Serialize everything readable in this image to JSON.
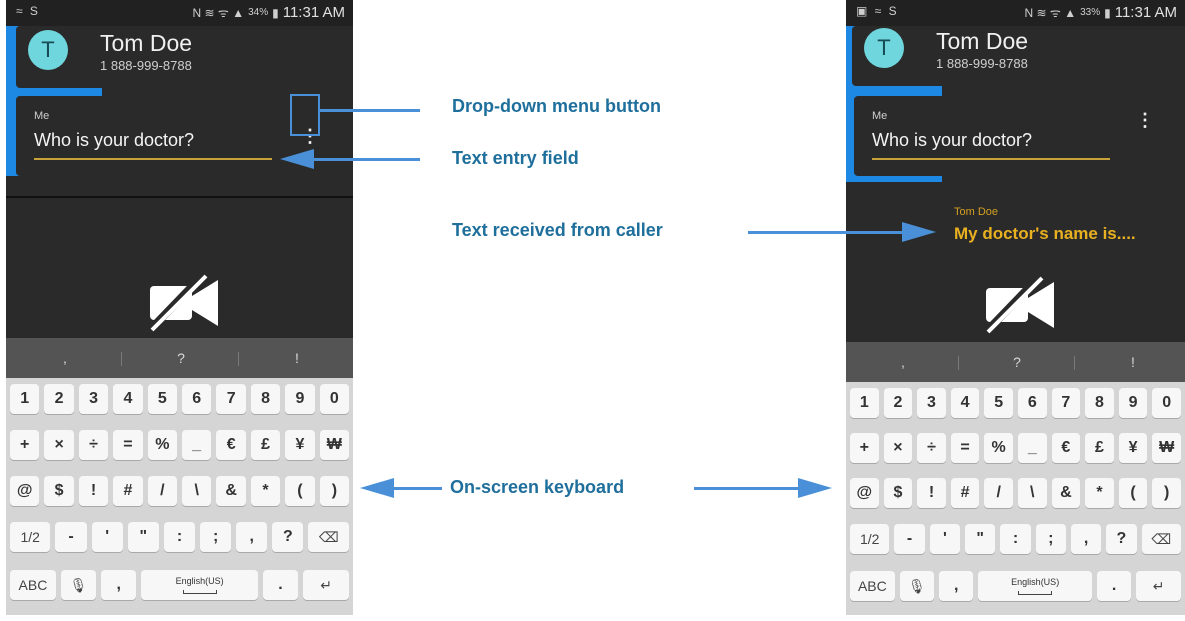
{
  "left_phone": {
    "status": {
      "left_icons": "≈ S",
      "signal_icons": "N ≋ ᯤ ▲",
      "battery": "34%",
      "time": "11:31 AM"
    },
    "contact": {
      "initial": "T",
      "name": "Tom Doe",
      "number": "1 888-999-8788"
    },
    "message": {
      "label": "Me",
      "text": "Who is your doctor?"
    },
    "menu_glyph": "⋮",
    "suggestions": [
      ",",
      "?",
      "!"
    ]
  },
  "right_phone": {
    "status": {
      "left_icons": "▣ ≈ S",
      "signal_icons": "N ≋ ᯤ ▲",
      "battery": "33%",
      "time": "11:31 AM"
    },
    "contact": {
      "initial": "T",
      "name": "Tom Doe",
      "number": "1 888-999-8788"
    },
    "message": {
      "label": "Me",
      "text": "Who is your doctor?"
    },
    "menu_glyph": "⋮",
    "received": {
      "name": "Tom Doe",
      "text": "My doctor's name is...."
    },
    "suggestions": [
      ",",
      "?",
      "!"
    ]
  },
  "keyboard": {
    "row1": [
      "1",
      "2",
      "3",
      "4",
      "5",
      "6",
      "7",
      "8",
      "9",
      "0"
    ],
    "row2": [
      "+",
      "×",
      "÷",
      "=",
      "%",
      "_",
      "€",
      "£",
      "¥",
      "₩"
    ],
    "row3": [
      "@",
      "$",
      "!",
      "#",
      "/",
      "\\",
      "&",
      "*",
      "(",
      ")"
    ],
    "row4": [
      "1/2",
      "-",
      "'",
      "\"",
      ":",
      ";",
      ",",
      "?",
      "⌫"
    ],
    "row5": {
      "abc": "ABC",
      "mic": "🎙",
      "comma": ",",
      "space": "English(US)",
      "dot": ".",
      "enter": "↵"
    }
  },
  "callouts": {
    "menu": "Drop-down menu button",
    "text_field": "Text entry field",
    "received": "Text received from caller",
    "keyboard": "On-screen keyboard"
  },
  "colors": {
    "accent": "#1e88e5",
    "callout": "#1f6f9c",
    "arrow": "#4a90d9",
    "received_text": "#e9b020",
    "underline": "#c9a33a"
  }
}
